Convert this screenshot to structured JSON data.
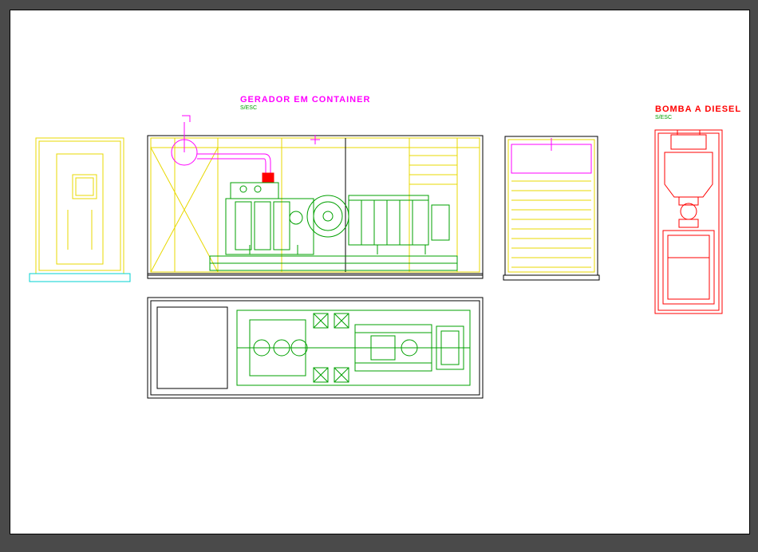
{
  "labels": {
    "generator_title": "GERADOR EM CONTAINER",
    "generator_sub": "S/ESC",
    "pump_title": "BOMBA A DIESEL",
    "pump_sub": "S/ESC"
  },
  "colors": {
    "yellow": "#e8d800",
    "green": "#00a000",
    "magenta": "#ff00ff",
    "cyan": "#00d0d0",
    "red": "#ff0000",
    "black": "#000000"
  }
}
